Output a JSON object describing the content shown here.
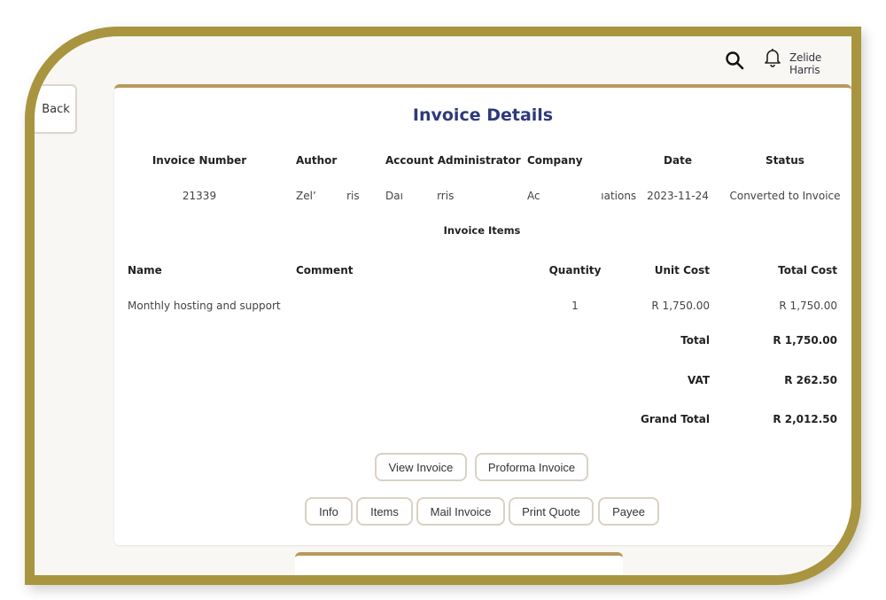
{
  "header": {
    "user_name": "Zelide Harris",
    "icons": [
      "search-icon",
      "bell-icon"
    ]
  },
  "nav": {
    "back_label": "Back"
  },
  "invoice": {
    "title": "Invoice Details",
    "columns": [
      "Invoice Number",
      "Author",
      "Account Administrator",
      "Company",
      "Date",
      "Status"
    ],
    "values": {
      "invoice_number": "21339",
      "author": "Zelʼ         ris",
      "account_administrator": "Daı          rris",
      "company": "Ac                  ıations",
      "date": "2023-11-24",
      "status": "Converted to Invoice"
    }
  },
  "items": {
    "section_title": "Invoice Items",
    "columns": [
      "Name",
      "Comment",
      "Quantity",
      "Unit Cost",
      "Total Cost"
    ],
    "rows": [
      {
        "name": "Monthly hosting and support",
        "comment": "",
        "quantity": "1",
        "unit_cost": "R 1,750.00",
        "total_cost": "R 1,750.00"
      }
    ]
  },
  "totals": {
    "total_label": "Total",
    "total_value": "R 1,750.00",
    "vat_label": "VAT",
    "vat_value": "R 262.50",
    "grand_total_label": "Grand Total",
    "grand_total_value": "R 2,012.50"
  },
  "actions": {
    "row1": [
      "View Invoice",
      "Proforma Invoice"
    ],
    "row2": [
      "Info",
      "Items",
      "Mail Invoice",
      "Print Quote",
      "Payee"
    ]
  },
  "colors": {
    "frame_gold": "#a9953f",
    "card_accent": "#b89a5c",
    "title_blue": "#2d3a7c"
  }
}
